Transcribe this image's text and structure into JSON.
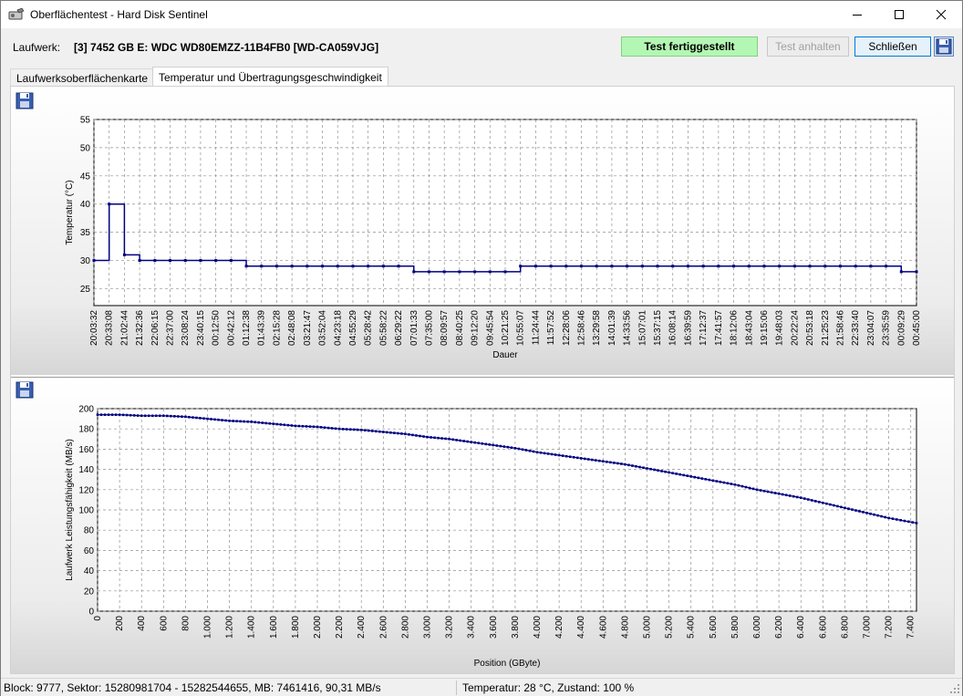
{
  "window": {
    "title": "Oberflächentest - Hard Disk Sentinel",
    "app_icon": "hard-disk-sentinel-icon",
    "controls": {
      "minimize": "minimize-icon",
      "maximize": "maximize-icon",
      "close": "close-icon"
    }
  },
  "drive": {
    "label": "Laufwerk:",
    "name": "[3] 7452 GB E: WDC WD80EMZZ-11B4FB0 [WD-CA059VJG]"
  },
  "toolbar": {
    "status": "Test fertiggestellt",
    "pause_label": "Test anhalten",
    "close_label": "Schließen",
    "save_icon": "floppy-disk-icon"
  },
  "colors": {
    "status_bg": "#b4f7b4",
    "plot_line": "#000080",
    "grid": "#909090"
  },
  "tabs": [
    {
      "label": "Laufwerksoberflächenkarte",
      "active": false
    },
    {
      "label": "Temperatur und Übertragungsgeschwindigkeit",
      "active": true
    }
  ],
  "chart_data": [
    {
      "type": "line",
      "xlabel": "Dauer",
      "ylabel": "Temperatur (°C)",
      "ylim": [
        22,
        55
      ],
      "yticks": [
        25,
        30,
        35,
        40,
        45,
        50,
        55
      ],
      "grid": true,
      "categories": [
        "20:03:32",
        "20:33:08",
        "21:02:44",
        "21:32:36",
        "22:06:15",
        "22:37:00",
        "23:08:24",
        "23:40:15",
        "00:12:50",
        "00:42:12",
        "01:12:38",
        "01:43:39",
        "02:15:28",
        "02:48:08",
        "03:21:47",
        "03:52:04",
        "04:23:18",
        "04:55:29",
        "05:28:42",
        "05:58:22",
        "06:29:22",
        "07:01:33",
        "07:35:00",
        "08:09:57",
        "08:40:25",
        "09:12:20",
        "09:45:54",
        "10:21:25",
        "10:55:07",
        "11:24:44",
        "11:57:52",
        "12:28:06",
        "12:58:46",
        "13:29:58",
        "14:01:39",
        "14:33:56",
        "15:07:01",
        "15:37:15",
        "16:08:14",
        "16:39:59",
        "17:12:37",
        "17:41:57",
        "18:12:06",
        "18:43:04",
        "19:15:06",
        "19:48:03",
        "20:22:24",
        "20:53:18",
        "21:25:23",
        "21:58:46",
        "22:33:40",
        "23:04:07",
        "23:35:59",
        "00:09:29",
        "00:45:00"
      ],
      "values": [
        30,
        40,
        31,
        30,
        30,
        30,
        30,
        30,
        30,
        30,
        29,
        29,
        29,
        29,
        29,
        29,
        29,
        29,
        29,
        29,
        29,
        28,
        28,
        28,
        28,
        28,
        28,
        28,
        29,
        29,
        29,
        29,
        29,
        29,
        29,
        29,
        29,
        29,
        29,
        29,
        29,
        29,
        29,
        29,
        29,
        29,
        29,
        29,
        29,
        29,
        29,
        29,
        29,
        28,
        28
      ]
    },
    {
      "type": "line",
      "xlabel": "Position (GByte)",
      "ylabel": "Laufwerk Leistungsfähigkeit (MB/s)",
      "xlim": [
        0,
        7452
      ],
      "ylim": [
        0,
        200
      ],
      "yticks": [
        0,
        20,
        40,
        60,
        80,
        100,
        120,
        140,
        160,
        180,
        200
      ],
      "xticks": [
        "0",
        "200",
        "400",
        "600",
        "800",
        "1.000",
        "1.200",
        "1.400",
        "1.600",
        "1.800",
        "2.000",
        "2.200",
        "2.400",
        "2.600",
        "2.800",
        "3.000",
        "3.200",
        "3.400",
        "3.600",
        "3.800",
        "4.000",
        "4.200",
        "4.400",
        "4.600",
        "4.800",
        "5.000",
        "5.200",
        "5.400",
        "5.600",
        "5.800",
        "6.000",
        "6.200",
        "6.400",
        "6.600",
        "6.800",
        "7.000",
        "7.200",
        "7.400"
      ],
      "grid": true,
      "x": [
        0,
        200,
        400,
        600,
        800,
        1000,
        1200,
        1400,
        1600,
        1800,
        2000,
        2200,
        2400,
        2600,
        2800,
        3000,
        3200,
        3400,
        3600,
        3800,
        4000,
        4200,
        4400,
        4600,
        4800,
        5000,
        5200,
        5400,
        5600,
        5800,
        6000,
        6200,
        6400,
        6600,
        6800,
        7000,
        7200,
        7452
      ],
      "values": [
        194,
        194,
        193,
        193,
        192,
        190,
        188,
        187,
        185,
        183,
        182,
        180,
        179,
        177,
        175,
        172,
        170,
        167,
        164,
        161,
        157,
        154,
        151,
        148,
        145,
        141,
        137,
        133,
        129,
        125,
        120,
        116,
        112,
        107,
        102,
        97,
        92,
        87
      ]
    }
  ],
  "statusbar": {
    "left": "Block: 9777, Sektor: 15280981704 - 15282544655, MB: 7461416, 90,31 MB/s",
    "right": "Temperatur: 28  °C,  Zustand: 100 %"
  }
}
